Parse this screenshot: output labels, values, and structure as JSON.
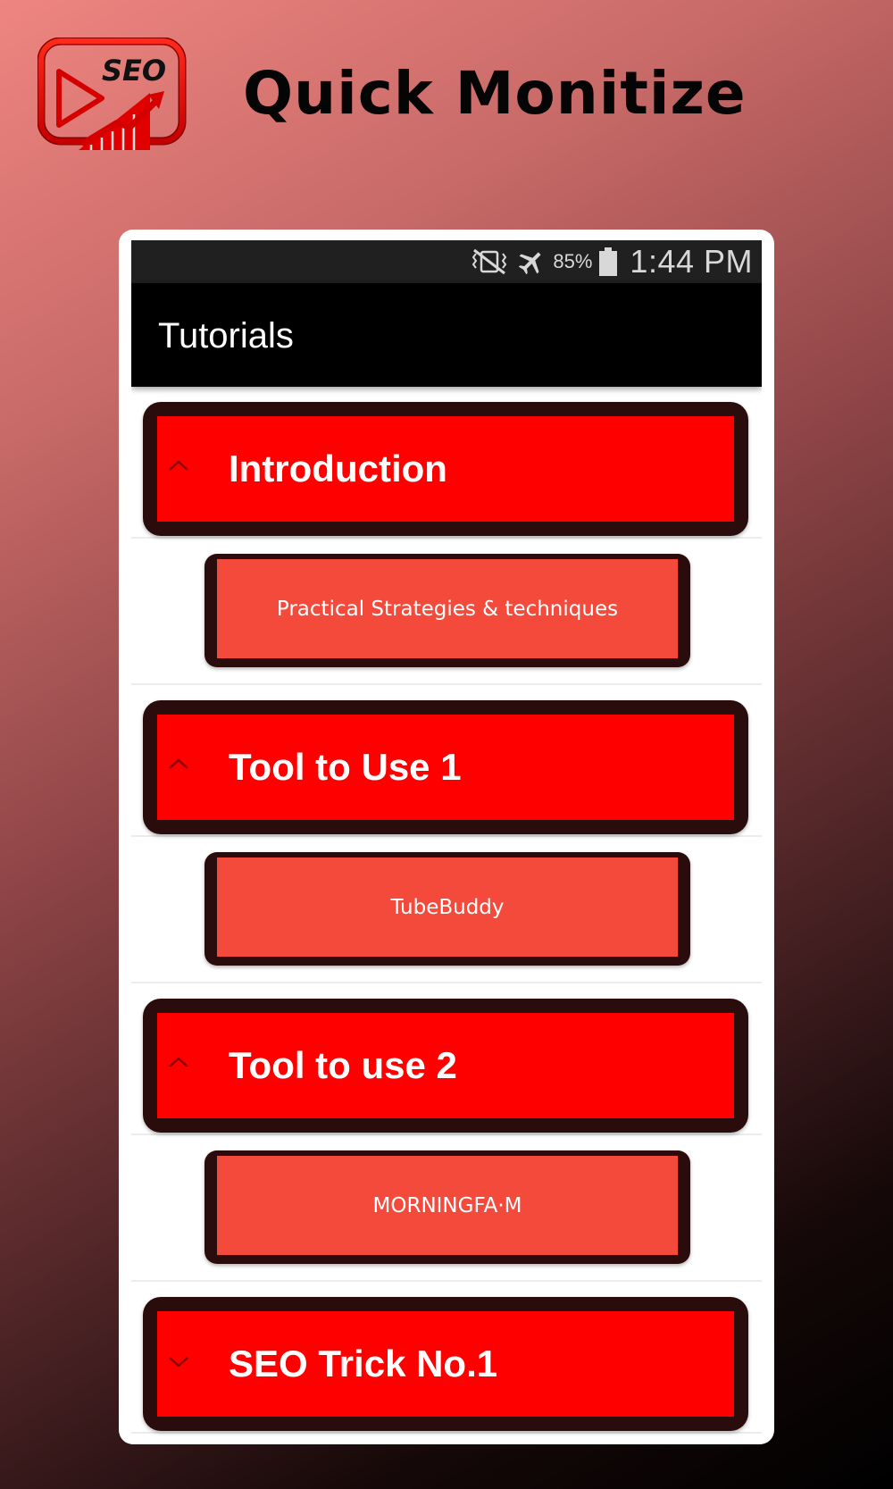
{
  "header": {
    "logo_text": "SEO",
    "title": "Quick Monitize"
  },
  "status_bar": {
    "battery_percent": "85%",
    "time": "1:44 PM",
    "icons": [
      "vibrate-mute-icon",
      "airplane-mode-icon",
      "battery-icon"
    ]
  },
  "app_bar": {
    "title": "Tutorials"
  },
  "list": [
    {
      "title": "Introduction",
      "expanded": true,
      "icon": "chevron-up-icon",
      "child": "Practical Strategies & techniques"
    },
    {
      "title": "Tool to Use 1",
      "expanded": true,
      "icon": "chevron-up-icon",
      "child": "TubeBuddy"
    },
    {
      "title": "Tool to use 2",
      "expanded": true,
      "icon": "chevron-up-icon",
      "child": "MORNINGFA·M"
    },
    {
      "title": "SEO Trick No.1",
      "expanded": false,
      "icon": "chevron-down-icon"
    }
  ],
  "colors": {
    "header_fill": "#ff0000",
    "child_fill": "#f44a3c",
    "card_border": "#2a0c0c",
    "app_bar": "#000000",
    "status_bar": "#202020"
  }
}
